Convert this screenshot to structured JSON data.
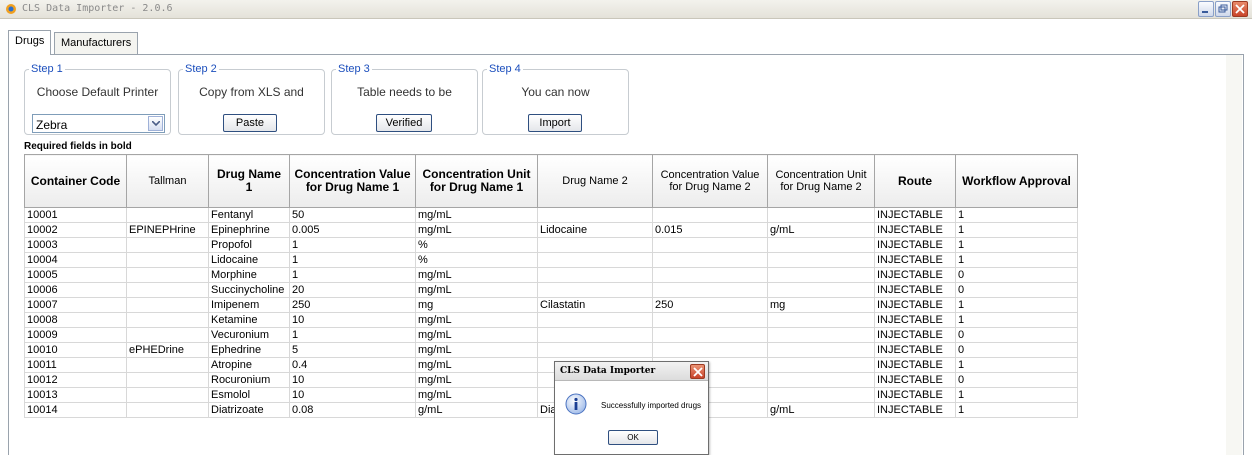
{
  "window": {
    "title": "CLS Data Importer - 2.0.6",
    "icon": "app-logo-icon"
  },
  "tabs": [
    {
      "label": "Drugs",
      "active": true
    },
    {
      "label": "Manufacturers",
      "active": false
    }
  ],
  "steps": [
    {
      "legend": "Step 1",
      "text": "Choose Default Printer",
      "control": "select",
      "selected": "Zebra"
    },
    {
      "legend": "Step 2",
      "text": "Copy from XLS and",
      "control": "button",
      "button": "Paste"
    },
    {
      "legend": "Step 3",
      "text": "Table needs to be",
      "control": "button",
      "button": "Verified"
    },
    {
      "legend": "Step 4",
      "text": "You can now",
      "control": "button",
      "button": "Import"
    }
  ],
  "required_note": "Required fields in bold",
  "table": {
    "columns": [
      {
        "label": "Container Code",
        "required": true
      },
      {
        "label": "Tallman",
        "required": false
      },
      {
        "label": "Drug Name 1",
        "required": true
      },
      {
        "label": "Concentration Value for Drug Name 1",
        "required": true
      },
      {
        "label": "Concentration Unit for Drug Name 1",
        "required": true
      },
      {
        "label": "Drug Name 2",
        "required": false
      },
      {
        "label": "Concentration Value for Drug Name 2",
        "required": false
      },
      {
        "label": "Concentration Unit for Drug Name 2",
        "required": false
      },
      {
        "label": "Route",
        "required": true
      },
      {
        "label": "Workflow Approval",
        "required": true
      }
    ],
    "rows": [
      [
        "10001",
        "",
        "Fentanyl",
        "50",
        "mg/mL",
        "",
        "",
        "",
        "INJECTABLE",
        "1"
      ],
      [
        "10002",
        "EPINEPHrine",
        "Epinephrine",
        "0.005",
        "mg/mL",
        "Lidocaine",
        "0.015",
        "g/mL",
        "INJECTABLE",
        "1"
      ],
      [
        "10003",
        "",
        "Propofol",
        "1",
        "%",
        "",
        "",
        "",
        "INJECTABLE",
        "1"
      ],
      [
        "10004",
        "",
        "Lidocaine",
        "1",
        "%",
        "",
        "",
        "",
        "INJECTABLE",
        "1"
      ],
      [
        "10005",
        "",
        "Morphine",
        "1",
        "mg/mL",
        "",
        "",
        "",
        "INJECTABLE",
        "0"
      ],
      [
        "10006",
        "",
        "Succinycholine",
        "20",
        "mg/mL",
        "",
        "",
        "",
        "INJECTABLE",
        "0"
      ],
      [
        "10007",
        "",
        "Imipenem",
        "250",
        "mg",
        "Cilastatin",
        "250",
        "mg",
        "INJECTABLE",
        "1"
      ],
      [
        "10008",
        "",
        "Ketamine",
        "10",
        "mg/mL",
        "",
        "",
        "",
        "INJECTABLE",
        "1"
      ],
      [
        "10009",
        "",
        "Vecuronium",
        "1",
        "mg/mL",
        "",
        "",
        "",
        "INJECTABLE",
        "0"
      ],
      [
        "10010",
        "ePHEDrine",
        "Ephedrine",
        "5",
        "mg/mL",
        "",
        "",
        "",
        "INJECTABLE",
        "0"
      ],
      [
        "10011",
        "",
        "Atropine",
        "0.4",
        "mg/mL",
        "",
        "",
        "",
        "INJECTABLE",
        "1"
      ],
      [
        "10012",
        "",
        "Rocuronium",
        "10",
        "mg/mL",
        "",
        "",
        "",
        "INJECTABLE",
        "0"
      ],
      [
        "10013",
        "",
        "Esmolol",
        "10",
        "mg/mL",
        "",
        "",
        "",
        "INJECTABLE",
        "1"
      ],
      [
        "10014",
        "",
        "Diatrizoate",
        "0.08",
        "g/mL",
        "Dia",
        "",
        "g/mL",
        "INJECTABLE",
        "1"
      ]
    ]
  },
  "dialog": {
    "title": "CLS Data Importer",
    "message": "Successfully imported drugs",
    "ok": "OK",
    "icon": "info-icon"
  },
  "colors": {
    "legend": "#1c4fbd",
    "close_button": "#c8432a"
  }
}
